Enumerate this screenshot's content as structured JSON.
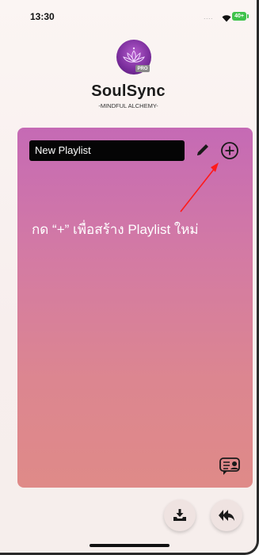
{
  "status_bar": {
    "time": "13:30",
    "signal": "....",
    "battery": "40+"
  },
  "brand": {
    "badge": "PRO",
    "name": "SoulSync",
    "tagline": "-MINDFUL ALCHEMY-"
  },
  "playlist": {
    "name_value": "New Playlist"
  },
  "hint": {
    "text": "กด “+” เพื่อสร้าง Playlist ใหม่",
    "arrow_color": "#ff1a1a"
  },
  "icons": {
    "edit": "pencil-icon",
    "add": "plus-circle-icon",
    "chat": "chat-bubble-icon",
    "download": "download-tray-icon",
    "back": "reply-all-icon"
  },
  "colors": {
    "card_top": "#c56ab5",
    "card_bottom": "#df8a88",
    "field_bg": "#050505"
  }
}
